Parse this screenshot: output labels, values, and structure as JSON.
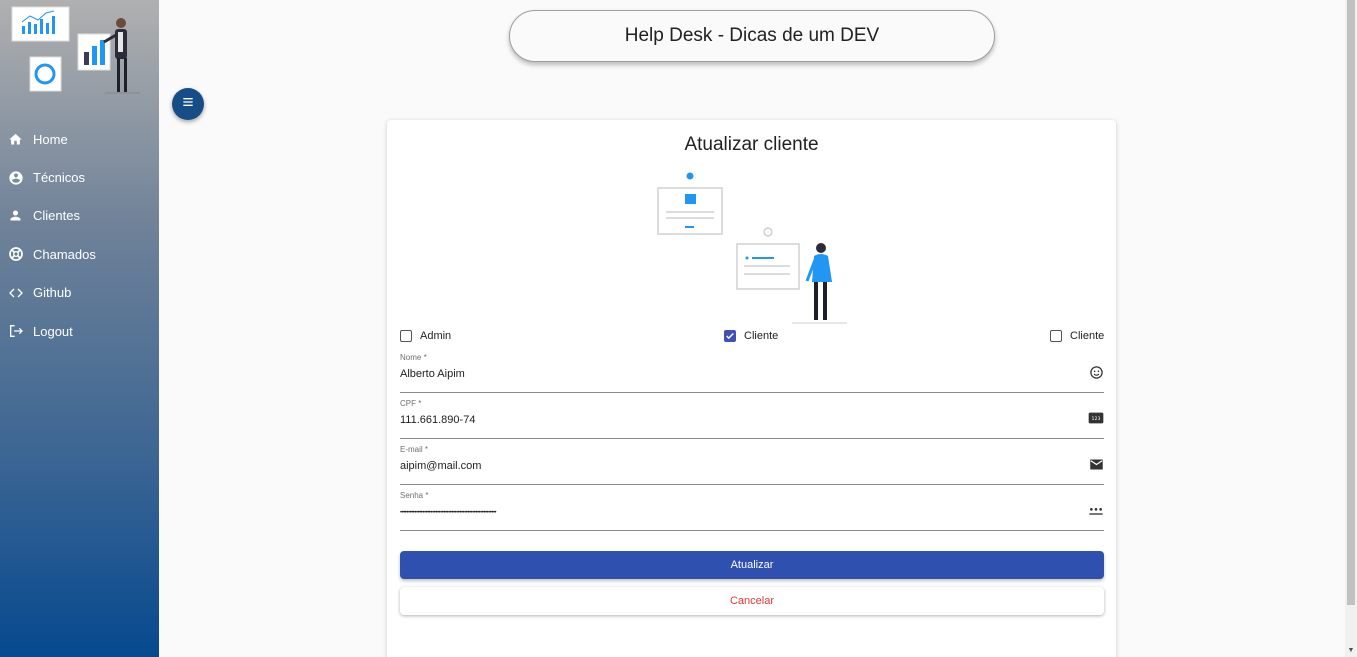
{
  "header": {
    "title": "Help Desk - Dicas de um DEV"
  },
  "sidebar": {
    "items": [
      {
        "label": "Home",
        "icon": "home-icon"
      },
      {
        "label": "Técnicos",
        "icon": "account-circle-icon"
      },
      {
        "label": "Clientes",
        "icon": "person-icon"
      },
      {
        "label": "Chamados",
        "icon": "support-icon"
      },
      {
        "label": "Github",
        "icon": "code-icon"
      },
      {
        "label": "Logout",
        "icon": "logout-icon"
      }
    ]
  },
  "form": {
    "title": "Atualizar cliente",
    "profiles": [
      {
        "label": "Admin",
        "checked": false
      },
      {
        "label": "Cliente",
        "checked": true
      },
      {
        "label": "Cliente",
        "checked": false
      }
    ],
    "fields": {
      "nome": {
        "label": "Nome *",
        "value": "Alberto Aipim",
        "icon": "emoji-icon"
      },
      "cpf": {
        "label": "CPF *",
        "value": "111.661.890-74",
        "icon": "numbers-icon"
      },
      "email": {
        "label": "E-mail *",
        "value": "aipim@mail.com",
        "icon": "mail-icon"
      },
      "senha": {
        "label": "Senha *",
        "value": "••••••••••••••••••••••••••••••••••••••••••••••••••••••••••••",
        "icon": "password-icon"
      }
    },
    "submit_label": "Atualizar",
    "cancel_label": "Cancelar"
  },
  "colors": {
    "primary": "#3050b0",
    "cancel": "#e53935",
    "sidebar_bottom": "#06498f"
  }
}
